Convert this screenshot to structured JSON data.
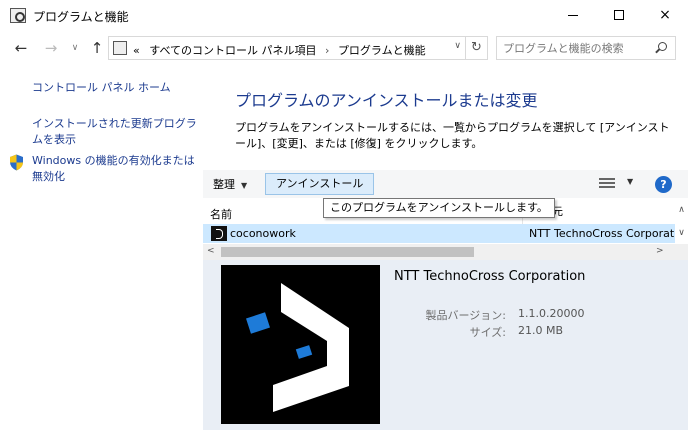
{
  "window": {
    "title": "プログラムと機能",
    "controls": {
      "minimize": "minimize-icon",
      "maximize": "maximize-icon",
      "close": "×"
    }
  },
  "navbar": {
    "back": "←",
    "forward": "→",
    "recent": "∨",
    "up": "↑",
    "breadcrumb_overflow": "«",
    "breadcrumbs": [
      "すべてのコントロール パネル項目",
      "プログラムと機能"
    ],
    "breadcrumb_separator": "›",
    "refresh": "↻",
    "search_placeholder": "プログラムと機能の検索"
  },
  "sidebar": {
    "items": [
      {
        "label": "コントロール パネル ホーム"
      },
      {
        "label": "インストールされた更新プログラムを表示"
      },
      {
        "label": "Windows の機能の有効化または無効化",
        "icon": "shield-icon"
      }
    ]
  },
  "main": {
    "title": "プログラムのアンインストールまたは変更",
    "description": "プログラムをアンインストールするには、一覧からプログラムを選択して [アンインストール]、[変更]、または [修復] をクリックします。"
  },
  "toolbar": {
    "organize_label": "整理",
    "uninstall_label": "アンインストール",
    "help_label": "?"
  },
  "tooltip": "このプログラムをアンインストールします。",
  "list": {
    "columns": [
      "名前",
      "発行元"
    ],
    "rows": [
      {
        "name": "coconowork",
        "publisher": "NTT TechnoCross Corporation",
        "selected": true
      }
    ]
  },
  "details": {
    "company": "NTT TechnoCross Corporation",
    "version_label": "製品バージョン:",
    "version_value": "1.1.0.20000",
    "size_label": "サイズ:",
    "size_value": "21.0 MB"
  },
  "colors": {
    "link": "#1c3b8f",
    "selection": "#cce8ff",
    "details_bg": "#e9eef5",
    "logo_accent": "#1e7bd8"
  }
}
